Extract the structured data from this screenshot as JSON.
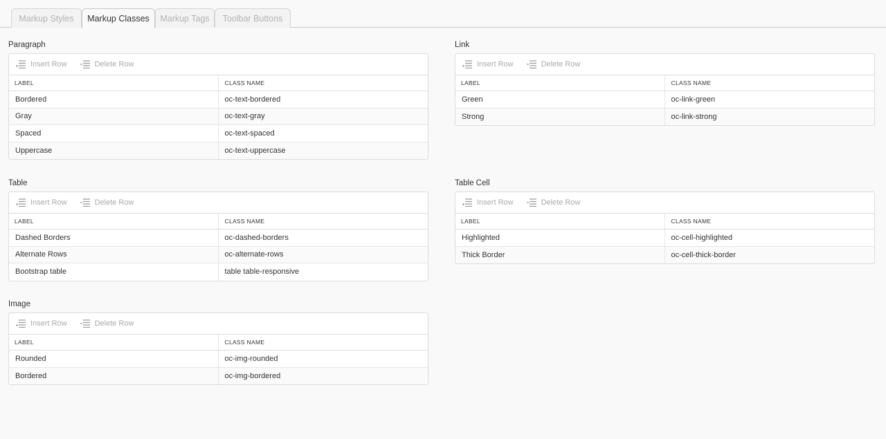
{
  "tabs": [
    {
      "label": "Markup Styles",
      "active": false
    },
    {
      "label": "Markup Classes",
      "active": true
    },
    {
      "label": "Markup Tags",
      "active": false
    },
    {
      "label": "Toolbar Buttons",
      "active": false
    }
  ],
  "toolbar": {
    "insert_label": "Insert Row",
    "delete_label": "Delete Row"
  },
  "columns": {
    "label": "LABEL",
    "class_name": "CLASS NAME"
  },
  "sections": {
    "paragraph": {
      "title": "Paragraph",
      "rows": [
        {
          "label": "Bordered",
          "class_name": "oc-text-bordered"
        },
        {
          "label": "Gray",
          "class_name": "oc-text-gray"
        },
        {
          "label": "Spaced",
          "class_name": "oc-text-spaced"
        },
        {
          "label": "Uppercase",
          "class_name": "oc-text-uppercase"
        }
      ]
    },
    "link": {
      "title": "Link",
      "rows": [
        {
          "label": "Green",
          "class_name": "oc-link-green"
        },
        {
          "label": "Strong",
          "class_name": "oc-link-strong"
        }
      ]
    },
    "table": {
      "title": "Table",
      "rows": [
        {
          "label": "Dashed Borders",
          "class_name": "oc-dashed-borders"
        },
        {
          "label": "Alternate Rows",
          "class_name": "oc-alternate-rows"
        },
        {
          "label": "Bootstrap table",
          "class_name": "table table-responsive"
        }
      ]
    },
    "tablecell": {
      "title": "Table Cell",
      "rows": [
        {
          "label": "Highlighted",
          "class_name": "oc-cell-highlighted"
        },
        {
          "label": "Thick Border",
          "class_name": "oc-cell-thick-border"
        }
      ]
    },
    "image": {
      "title": "Image",
      "rows": [
        {
          "label": "Rounded",
          "class_name": "oc-img-rounded"
        },
        {
          "label": "Bordered",
          "class_name": "oc-img-bordered"
        }
      ]
    }
  },
  "icons": {
    "insert": "insert-row-icon",
    "delete": "delete-row-icon"
  },
  "colors": {
    "background": "#f9f9f9",
    "panel": "#ffffff",
    "border": "#dcdcdc",
    "muted_text": "#aaaaaa",
    "text": "#333333"
  }
}
